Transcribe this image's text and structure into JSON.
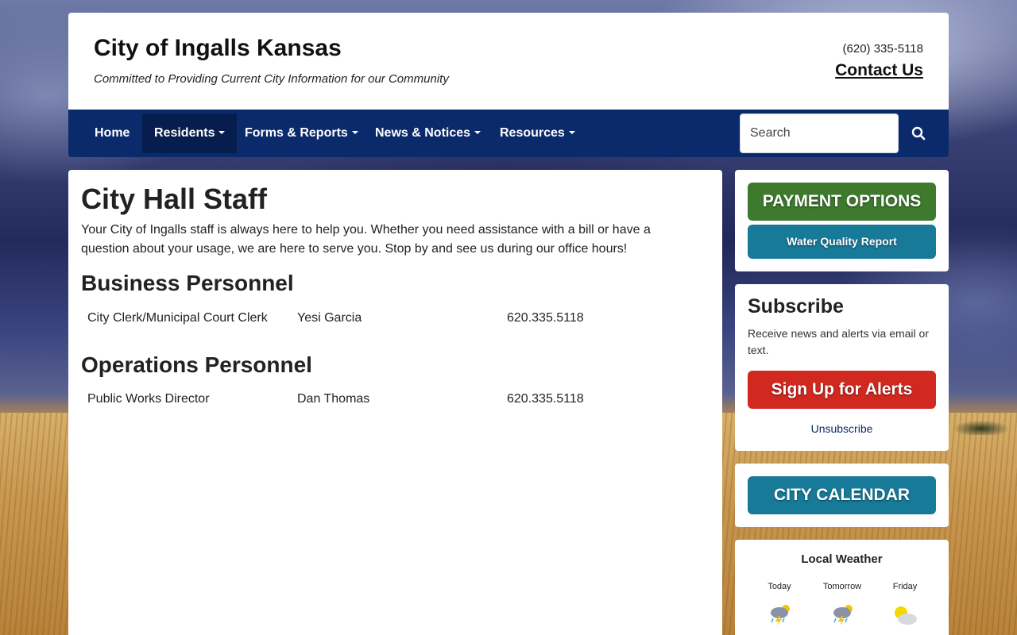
{
  "header": {
    "title": "City of Ingalls Kansas",
    "tagline": "Committed to Providing Current City Information for our Community",
    "phone": "(620) 335-5118",
    "contact_label": "Contact Us"
  },
  "nav": {
    "items": [
      {
        "label": "Home",
        "dropdown": false,
        "active": false
      },
      {
        "label": "Residents",
        "dropdown": true,
        "active": true
      },
      {
        "label": "Forms & Reports",
        "dropdown": true,
        "active": false
      },
      {
        "label": "News & Notices",
        "dropdown": true,
        "active": false
      },
      {
        "label": "Resources",
        "dropdown": true,
        "active": false
      }
    ],
    "search_placeholder": "Search",
    "search_icon": "search-icon"
  },
  "main": {
    "title": "City Hall Staff",
    "intro": "Your City of Ingalls staff is always here to help you. Whether you need assistance with a bill or have a question about your usage, we are here to serve you. Stop by and see us during our office hours!",
    "sections": [
      {
        "heading": "Business Personnel",
        "rows": [
          {
            "title": "City Clerk/Municipal Court Clerk",
            "name": "Yesi Garcia",
            "phone": "620.335.5118"
          }
        ]
      },
      {
        "heading": "Operations Personnel",
        "rows": [
          {
            "title": "Public Works Director",
            "name": "Dan Thomas",
            "phone": "620.335.5118"
          }
        ]
      }
    ]
  },
  "sidebar": {
    "payment_label": "PAYMENT OPTIONS",
    "water_label": "Water Quality Report",
    "subscribe": {
      "title": "Subscribe",
      "text": "Receive news and alerts via email or text.",
      "signup_label": "Sign Up for Alerts",
      "unsubscribe_label": "Unsubscribe"
    },
    "calendar_label": "CITY CALENDAR",
    "weather": {
      "title": "Local Weather",
      "days": [
        {
          "label": "Today",
          "icon": "thunderstorm-sun-icon"
        },
        {
          "label": "Tomorrow",
          "icon": "thunderstorm-sun-icon"
        },
        {
          "label": "Friday",
          "icon": "partly-cloudy-icon"
        }
      ]
    }
  },
  "colors": {
    "nav_bg": "#0b2a6b",
    "payment_green": "#3d7a2e",
    "teal": "#177a99",
    "alert_red": "#d1281f"
  }
}
